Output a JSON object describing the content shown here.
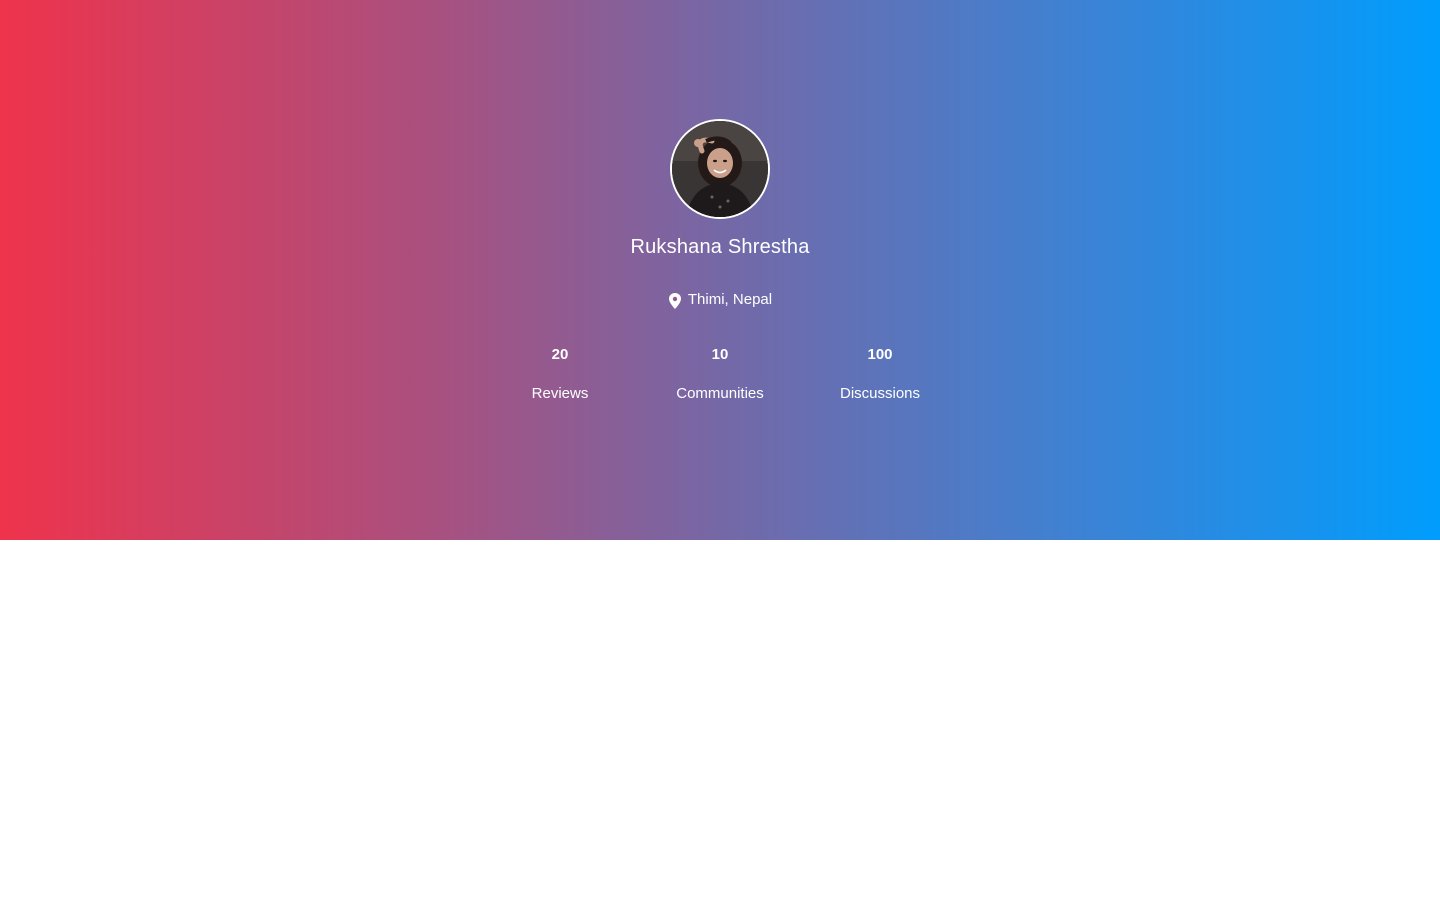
{
  "profile": {
    "name": "Rukshana Shrestha",
    "location": "Thimi, Nepal",
    "location_icon": "map-pin-icon",
    "avatar": "user-photo"
  },
  "stats": [
    {
      "value": "20",
      "label": "Reviews"
    },
    {
      "value": "10",
      "label": "Communities"
    },
    {
      "value": "100",
      "label": "Discussions"
    }
  ],
  "colors": {
    "gradient_start": "#ef334c",
    "gradient_end": "#009dfd",
    "text": "#ffffff",
    "page_background": "#ffffff"
  }
}
